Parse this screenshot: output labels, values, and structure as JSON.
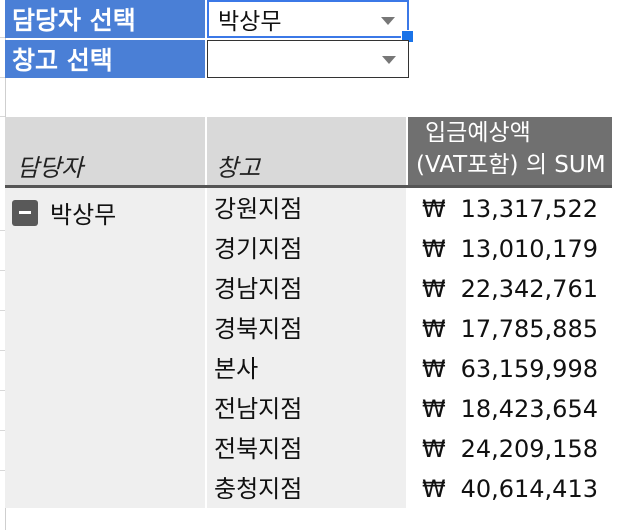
{
  "filters": {
    "manager": {
      "label": "담당자 선택",
      "value": "박상무"
    },
    "warehouse": {
      "label": "창고 선택",
      "value": ""
    }
  },
  "pivot": {
    "headers": {
      "manager": "담당자",
      "warehouse": "창고",
      "value_line1": "입금예상액",
      "value_line2": "(VAT포함) 의 SUM"
    },
    "group": {
      "manager": "박상무"
    },
    "currency_symbol": "₩",
    "rows": [
      {
        "warehouse": "강원지점",
        "amount": "13,317,522"
      },
      {
        "warehouse": "경기지점",
        "amount": "13,010,179"
      },
      {
        "warehouse": "경남지점",
        "amount": "22,342,761"
      },
      {
        "warehouse": "경북지점",
        "amount": "17,785,885"
      },
      {
        "warehouse": "본사",
        "amount": "63,159,998"
      },
      {
        "warehouse": "전남지점",
        "amount": "18,423,654"
      },
      {
        "warehouse": "전북지점",
        "amount": "24,209,158"
      },
      {
        "warehouse": "충청지점",
        "amount": "40,614,413"
      }
    ]
  },
  "colors": {
    "filter_label_bg": "#4a7fd6",
    "select_active_border": "#3b78e7",
    "pivot_header_bg": "#d9d9d9",
    "pivot_value_header_bg": "#707070",
    "pivot_body_bg": "#efefef"
  }
}
